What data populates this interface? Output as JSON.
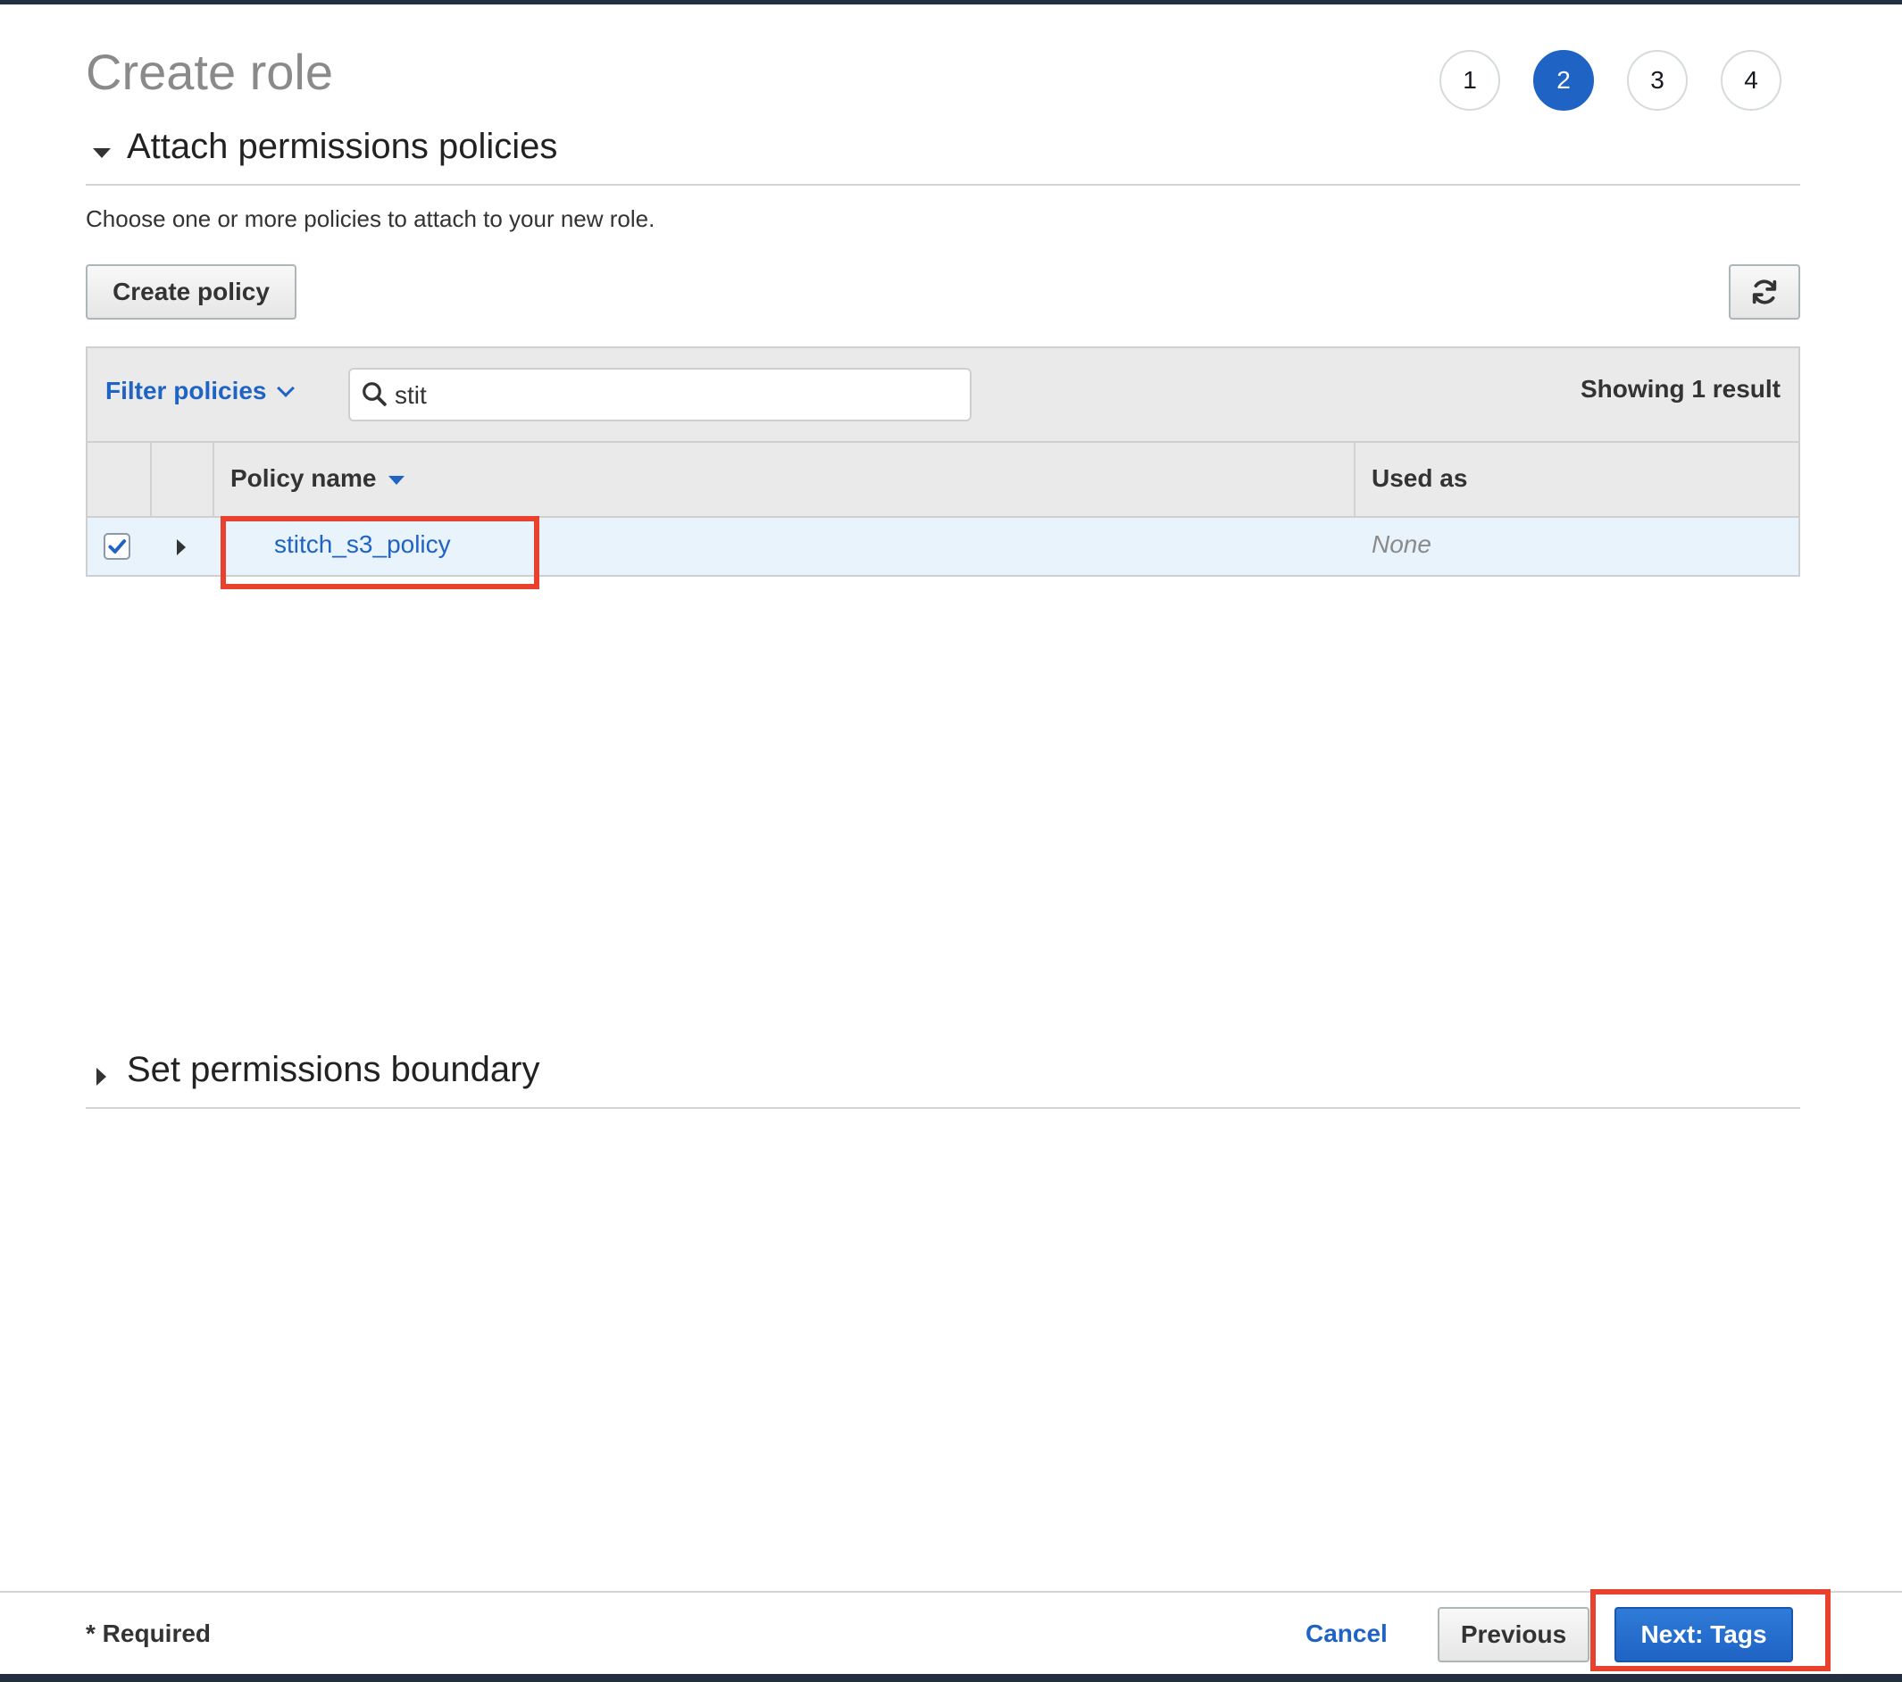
{
  "page": {
    "title": "Create role"
  },
  "steps": [
    {
      "label": "1",
      "active": false
    },
    {
      "label": "2",
      "active": true
    },
    {
      "label": "3",
      "active": false
    },
    {
      "label": "4",
      "active": false
    }
  ],
  "attach_section": {
    "title": "Attach permissions policies",
    "description": "Choose one or more policies to attach to your new role.",
    "create_policy_label": "Create policy",
    "refresh_icon": "refresh-icon"
  },
  "toolbar": {
    "filter_label": "Filter policies",
    "search_value": "stit",
    "showing_text": "Showing 1 result"
  },
  "table": {
    "columns": {
      "policy_name": "Policy name",
      "used_as": "Used as"
    },
    "rows": [
      {
        "checked": true,
        "policy_name": "stitch_s3_policy",
        "used_as": "None"
      }
    ]
  },
  "boundary_section": {
    "title": "Set permissions boundary"
  },
  "footer": {
    "required_label": "* Required",
    "cancel_label": "Cancel",
    "previous_label": "Previous",
    "next_label": "Next: Tags"
  },
  "colors": {
    "accent": "#1f63c4",
    "highlight": "#e8412d",
    "row_selected": "#e8f3fc"
  }
}
